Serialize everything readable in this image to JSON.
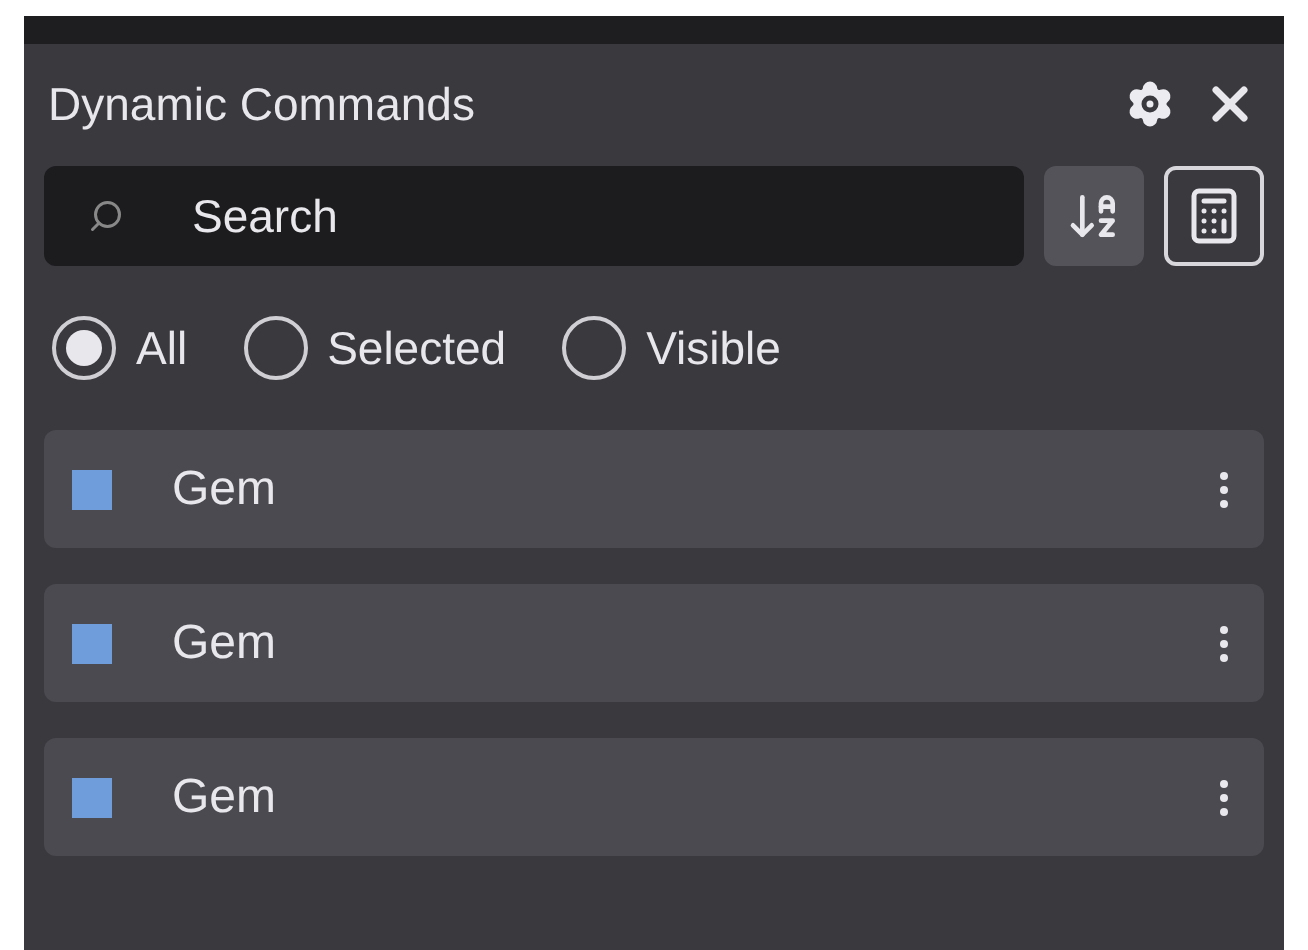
{
  "panel": {
    "title": "Dynamic Commands"
  },
  "search": {
    "placeholder": "Search"
  },
  "filters": [
    {
      "label": "All",
      "selected": true
    },
    {
      "label": "Selected",
      "selected": false
    },
    {
      "label": "Visible",
      "selected": false
    }
  ],
  "commands": [
    {
      "name": "Gem",
      "color": "#6f9ddc"
    },
    {
      "name": "Gem",
      "color": "#6f9ddc"
    },
    {
      "name": "Gem",
      "color": "#6f9ddc"
    }
  ]
}
